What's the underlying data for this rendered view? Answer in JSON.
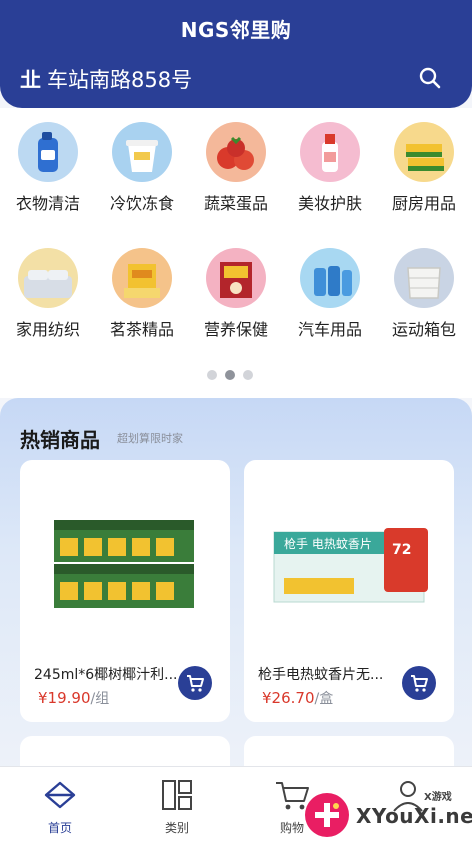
{
  "header": {
    "title": "NGS邻里购",
    "location_prefix": "㐀",
    "location": "车站南路858号"
  },
  "categories": [
    {
      "label": "衣物清洁",
      "icon": "detergent-icon"
    },
    {
      "label": "冷饮冻食",
      "icon": "ice-cream-icon"
    },
    {
      "label": "蔬菜蛋品",
      "icon": "vegetables-icon"
    },
    {
      "label": "美妆护肤",
      "icon": "lotion-icon"
    },
    {
      "label": "厨房用品",
      "icon": "sponge-icon"
    },
    {
      "label": "家用纺织",
      "icon": "bedding-icon"
    },
    {
      "label": "茗茶精品",
      "icon": "tea-icon"
    },
    {
      "label": "营养保健",
      "icon": "supplement-icon"
    },
    {
      "label": "汽车用品",
      "icon": "water-bottle-icon"
    },
    {
      "label": "运动箱包",
      "icon": "storage-bag-icon"
    }
  ],
  "carousel": {
    "pages": 3,
    "active": 2
  },
  "hot": {
    "title": "热销商品",
    "subtitle": "超划算限时家"
  },
  "products": [
    {
      "name": "245ml*6椰树椰汁利...",
      "price": "¥19.90",
      "unit": "/组"
    },
    {
      "name": "枪手电热蚊香片无...",
      "price": "¥26.70",
      "unit": "/盒",
      "pack_text": "枪手 电热蚊香片",
      "badge_text": "72"
    }
  ],
  "tabs": [
    {
      "label": "首页",
      "icon": "home-icon",
      "active": true
    },
    {
      "label": "类别",
      "icon": "category-icon",
      "active": false
    },
    {
      "label": "购物",
      "icon": "cart-icon",
      "active": false
    },
    {
      "label": "",
      "icon": "user-icon",
      "active": false
    }
  ],
  "watermark": {
    "text": "XYouXi.net",
    "small": "X游戏"
  },
  "colors": {
    "brand": "#2a3f96",
    "price": "#d9382b"
  }
}
